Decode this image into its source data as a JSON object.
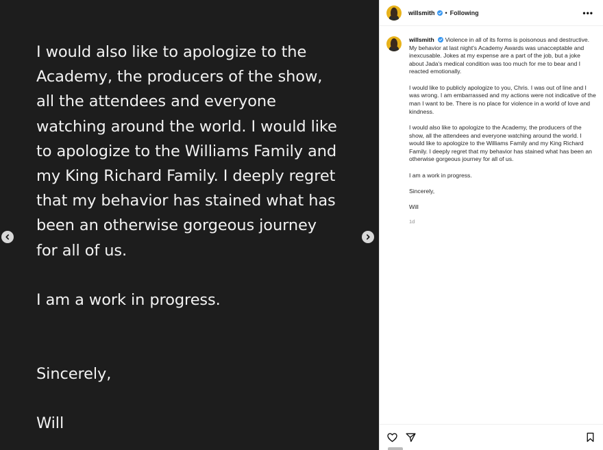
{
  "media": {
    "lines_paragraph1": [
      "I would also like to apologize to the",
      "Academy, the producers of the show,",
      "all the attendees and everyone",
      "watching around the world. I would like",
      "to apologize to the Williams Family and",
      "my King Richard Family. I deeply regret",
      "that my behavior has stained what has",
      "been an otherwise gorgeous journey",
      "for all of us."
    ],
    "line_progress": "I am a work in progress.",
    "line_sincerely": "Sincerely,",
    "line_will": "Will"
  },
  "header": {
    "username": "willsmith",
    "separator": "•",
    "follow_status": "Following",
    "more_label": "•••"
  },
  "caption": {
    "username": "willsmith",
    "first_paragraph": "Violence in all of its forms is poisonous and destructive. My behavior at last night's Academy Awards was unacceptable and inexcusable. Jokes at my expense are a part of the job, but a joke about Jada's medical condition was too much for me to bear and I reacted emotionally.",
    "paragraph2": "I would like to publicly apologize to you, Chris. I was out of line and I was wrong. I am embarrassed and my actions were not indicative of the man I want to be. There is no place for violence in a world of love and kindness.",
    "paragraph3": "I would also like to apologize to the Academy, the producers of the show, all the attendees and everyone watching around the world. I would like to apologize to the Williams Family and my King Richard Family. I deeply regret that my behavior has stained what has been an otherwise gorgeous journey for all of us.",
    "paragraph4": "I am a work in progress.",
    "paragraph5": "Sincerely,",
    "paragraph6": "Will",
    "timestamp": "1d"
  },
  "icons": {
    "prev": "chevron-left-icon",
    "next": "chevron-right-icon",
    "like": "heart-icon",
    "share": "paper-plane-icon",
    "save": "bookmark-icon",
    "verified": "verified-badge-icon"
  },
  "colors": {
    "media_bg": "#1d1d1d",
    "media_text": "#f2f2f2",
    "verified": "#3897f0",
    "muted": "#8e8e8e"
  }
}
